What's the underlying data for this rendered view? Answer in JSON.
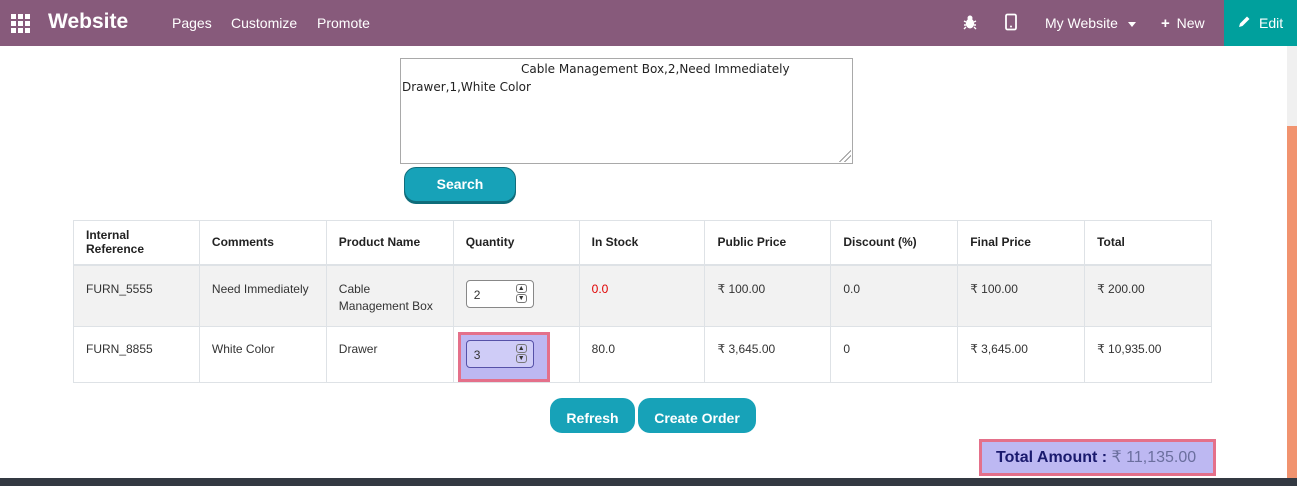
{
  "navbar": {
    "brand": "Website",
    "links": [
      "Pages",
      "Customize",
      "Promote"
    ],
    "my_website": "My Website",
    "new_label": "New",
    "edit_label": "Edit",
    "colors": {
      "bar": "#875a7b",
      "edit": "#00a09d"
    }
  },
  "search": {
    "lines": [
      "Cable Management Box,2,Need Immediately",
      "Drawer,1,White Color"
    ],
    "button": "Search"
  },
  "table": {
    "headers": [
      "Internal Reference",
      "Comments",
      "Product Name",
      "Quantity",
      "In Stock",
      "Public Price",
      "Discount (%)",
      "Final Price",
      "Total"
    ],
    "rows": [
      {
        "ref": "FURN_5555",
        "comment": "Need Immediately",
        "product": "Cable Management Box",
        "qty": "2",
        "stock": "0.0",
        "public_price": "₹ 100.00",
        "discount": "0.0",
        "final_price": "₹ 100.00",
        "total": "₹ 200.00"
      },
      {
        "ref": "FURN_8855",
        "comment": "White Color",
        "product": "Drawer",
        "qty": "3",
        "stock": "80.0",
        "public_price": "₹ 3,645.00",
        "discount": "0",
        "final_price": "₹ 3,645.00",
        "total": "₹ 10,935.00"
      }
    ]
  },
  "actions": {
    "refresh": "Refresh",
    "create_order": "Create Order"
  },
  "total": {
    "label": "Total Amount :",
    "amount": "₹ 11,135.00"
  }
}
